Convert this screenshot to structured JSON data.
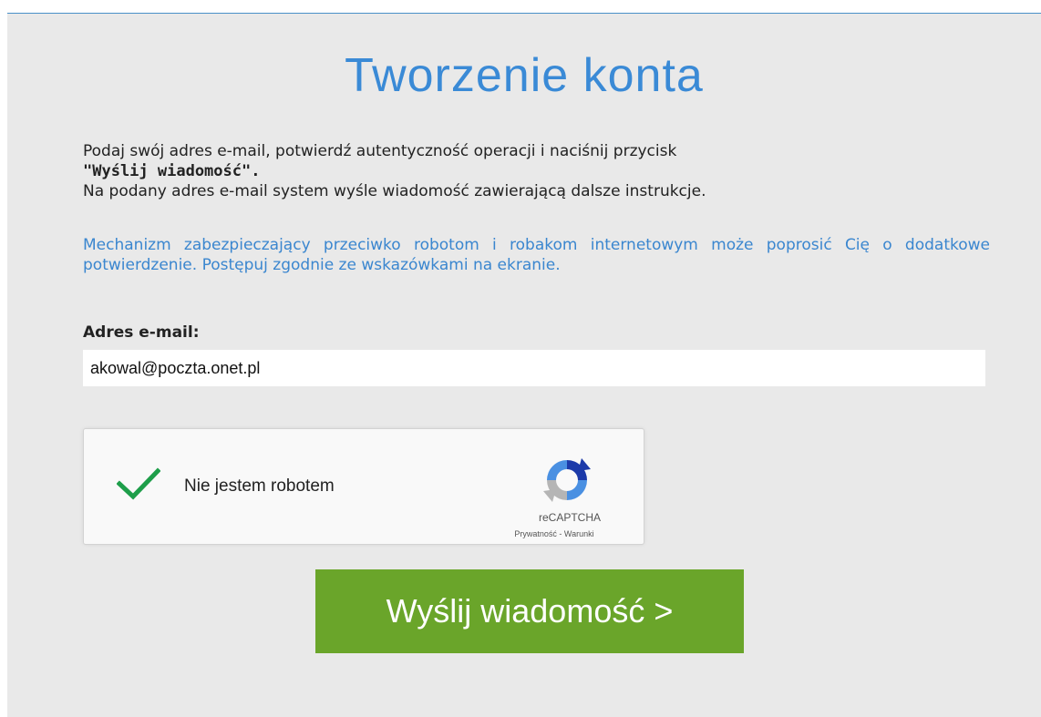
{
  "title": "Tworzenie konta",
  "intro": {
    "line1": "Podaj swój adres e-mail, potwierdź autentyczność operacji i naciśnij przycisk",
    "button_ref": "\"Wyślij wiadomość\".",
    "line2": "Na podany adres e-mail system wyśle wiadomość zawierającą dalsze instrukcje."
  },
  "warning": "Mechanizm zabezpieczający przeciwko robotom i robakom internetowym może poprosić Cię o dodatkowe potwierdzenie. Postępuj zgodnie ze wskazówkami na ekranie.",
  "email": {
    "label": "Adres e-mail:",
    "value": "akowal@poczta.onet.pl"
  },
  "captcha": {
    "label": "Nie jestem robotem",
    "brand": "reCAPTCHA",
    "privacy": "Prywatność",
    "separator": " - ",
    "terms": "Warunki",
    "checked": true,
    "check_color": "#1e9e4a",
    "check_icon": "checkmark-icon",
    "logo_icon": "recaptcha-logo-icon"
  },
  "send_button": {
    "label": "Wyślij wiadomość >",
    "color": "#6aa52a"
  },
  "colors": {
    "accent": "#3a8ad6",
    "background": "#e9e9e9"
  }
}
